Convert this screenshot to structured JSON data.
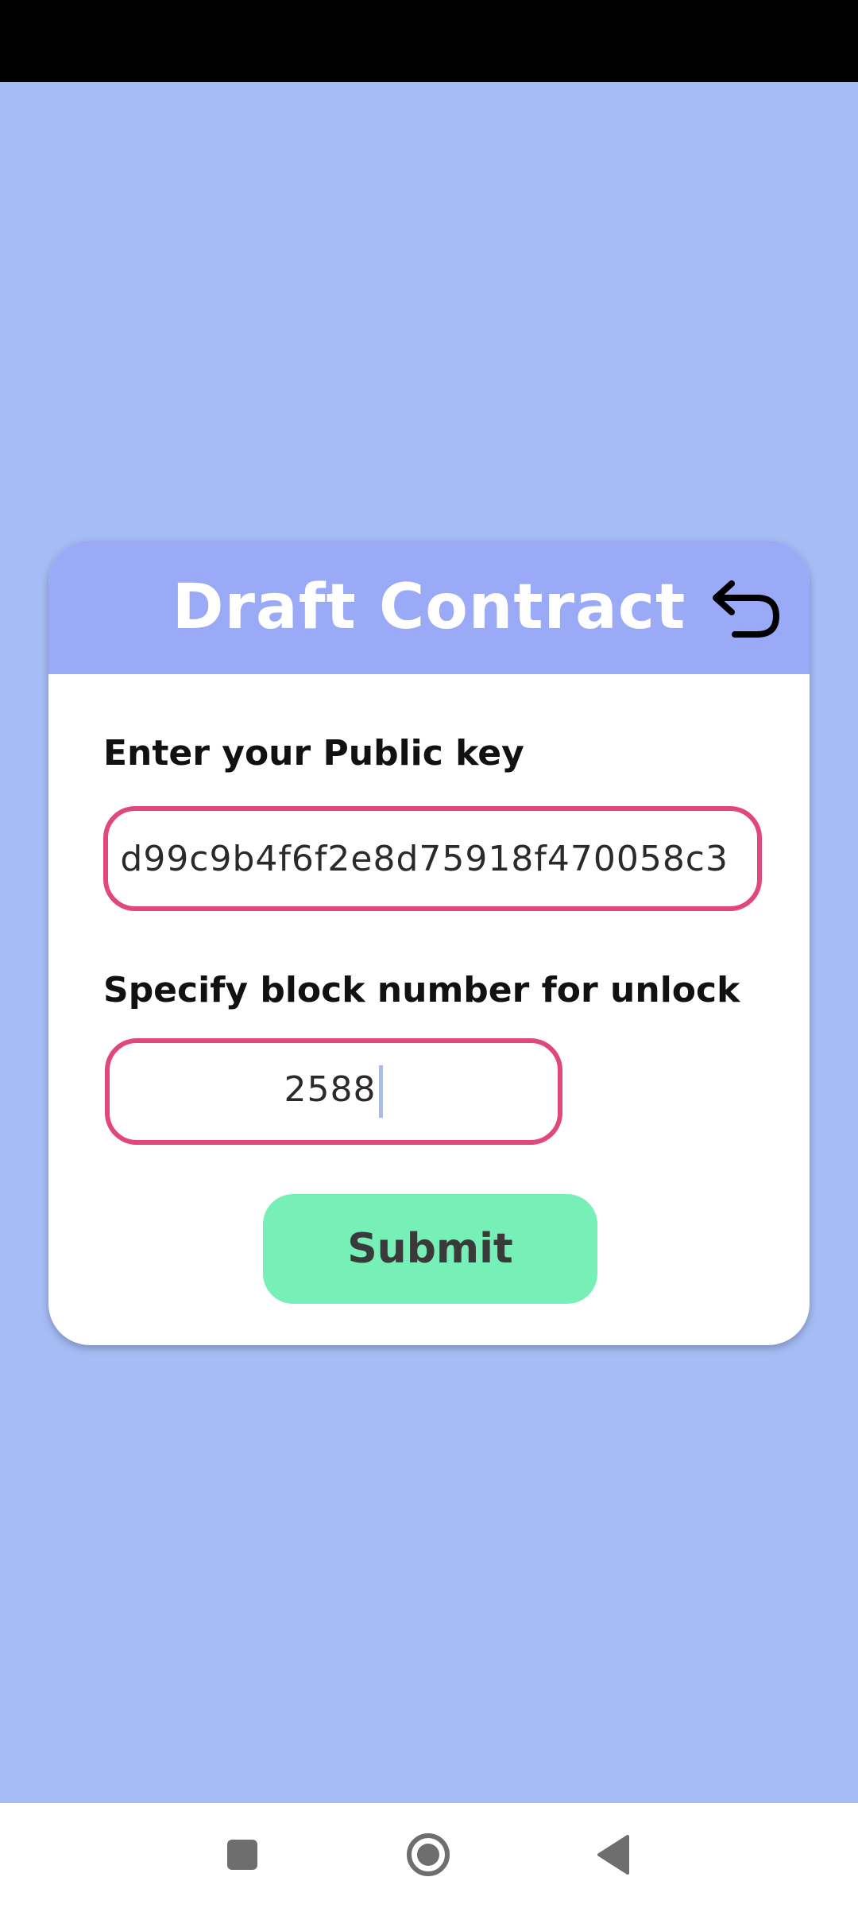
{
  "colors": {
    "background": "#a5bcf5",
    "header": "#9aaaf6",
    "field_border": "#e0487c",
    "submit": "#76f0b7"
  },
  "card": {
    "title": "Draft Contract",
    "back_icon": "undo-arrow-icon"
  },
  "form": {
    "public_key_label": "Enter your Public key",
    "public_key_value": "d99c9b4f6f2e8d75918f470058c3",
    "block_label": "Specify block number for unlock",
    "block_value": "2588",
    "submit_label": "Submit"
  },
  "nav": {
    "recents_icon": "square-icon",
    "home_icon": "circle-home-icon",
    "back_icon": "triangle-back-icon"
  }
}
